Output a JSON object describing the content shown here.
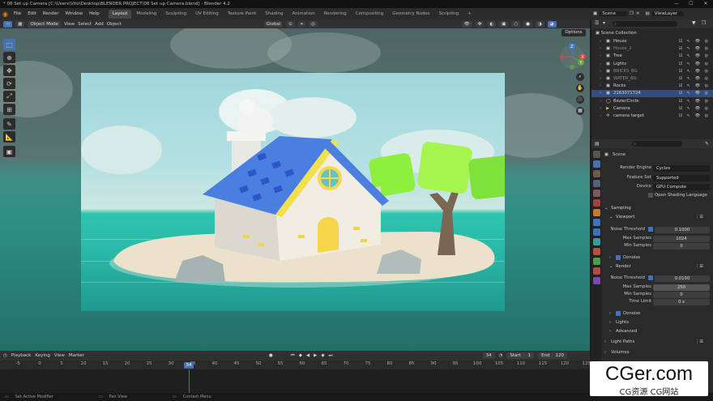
{
  "window": {
    "title": "* 08 Set up Camera [C:\\Users\\Vito\\Desktop\\BLENDER PROJECT\\08 Set up Camera.blend] - Blender 4.2"
  },
  "menus": [
    "File",
    "Edit",
    "Render",
    "Window",
    "Help"
  ],
  "workspaces": [
    {
      "label": "Layout",
      "active": true
    },
    {
      "label": "Modeling"
    },
    {
      "label": "Sculpting"
    },
    {
      "label": "UV Editing"
    },
    {
      "label": "Texture Paint"
    },
    {
      "label": "Shading"
    },
    {
      "label": "Animation"
    },
    {
      "label": "Rendering"
    },
    {
      "label": "Compositing"
    },
    {
      "label": "Geometry Nodes"
    },
    {
      "label": "Scripting"
    }
  ],
  "workspace_add": "+",
  "topright": {
    "scene": "Scene",
    "view_layer": "ViewLayer"
  },
  "viewport_header": {
    "mode": "Object Mode",
    "menus": [
      "View",
      "Select",
      "Add",
      "Object"
    ],
    "transform": "Global"
  },
  "viewport": {
    "options": "Options"
  },
  "tools": [
    "select-box",
    "cursor",
    "move",
    "rotate",
    "scale",
    "transform",
    "annotate",
    "measure",
    "add-cube"
  ],
  "nav_gizmo": [
    "Z",
    "X",
    "Y"
  ],
  "outliner": {
    "search_placeholder": "",
    "root": "Scene Collection",
    "items": [
      {
        "name": "House",
        "selected": false
      },
      {
        "name": "House_2",
        "selected": false
      },
      {
        "name": "Tree",
        "selected": false
      },
      {
        "name": "Lights",
        "selected": false
      },
      {
        "name": "BRICKS_BG",
        "selected": false
      },
      {
        "name": "WATER_BG",
        "selected": false
      },
      {
        "name": "Rocks",
        "selected": false
      },
      {
        "name": "2163071724",
        "selected": true
      },
      {
        "name": "BézierCircle",
        "selected": false
      },
      {
        "name": "Camera",
        "selected": false
      },
      {
        "name": "camera target",
        "selected": false
      }
    ]
  },
  "properties": {
    "scene_label": "Scene",
    "render_engine_label": "Render Engine",
    "render_engine": "Cycles",
    "feature_set_label": "Feature Set",
    "feature_set": "Supported",
    "device_label": "Device",
    "device": "GPU Compute",
    "osl_label": "Open Shading Language",
    "sampling": "Sampling",
    "viewport": "Viewport",
    "noise_threshold_label": "Noise Threshold",
    "viewport_noise_threshold": "0.1000",
    "max_samples_label": "Max Samples",
    "viewport_max_samples": "1024",
    "min_samples_label": "Min Samples",
    "viewport_min_samples": "0",
    "denoise_label": "Denoise",
    "render": "Render",
    "render_noise_threshold": "0.0100",
    "render_max_samples": "250",
    "render_min_samples": "0",
    "time_limit_label": "Time Limit",
    "time_limit": "0 s",
    "lights": "Lights",
    "advanced": "Advanced",
    "light_paths": "Light Paths",
    "volumes": "Volumes"
  },
  "timeline": {
    "playback": "Playback",
    "keying": "Keying",
    "view": "View",
    "marker": "Marker",
    "current_frame": "34",
    "start_label": "Start",
    "start": "1",
    "end_label": "End",
    "end": "120",
    "ticks": [
      "-5",
      "0",
      "5",
      "10",
      "15",
      "20",
      "25",
      "30",
      "35",
      "40",
      "45",
      "50",
      "55",
      "60",
      "65",
      "70",
      "75",
      "80",
      "85",
      "90",
      "95",
      "100",
      "105",
      "110",
      "115",
      "120",
      "125"
    ]
  },
  "statusbar": [
    "Set Active Modifier",
    "Pan View",
    "Context Menu"
  ],
  "watermark": {
    "main": "CGer.com",
    "sub": "CG资源 CG网站"
  },
  "colors": {
    "accent": "#4772b3",
    "selection": "#334d80"
  }
}
